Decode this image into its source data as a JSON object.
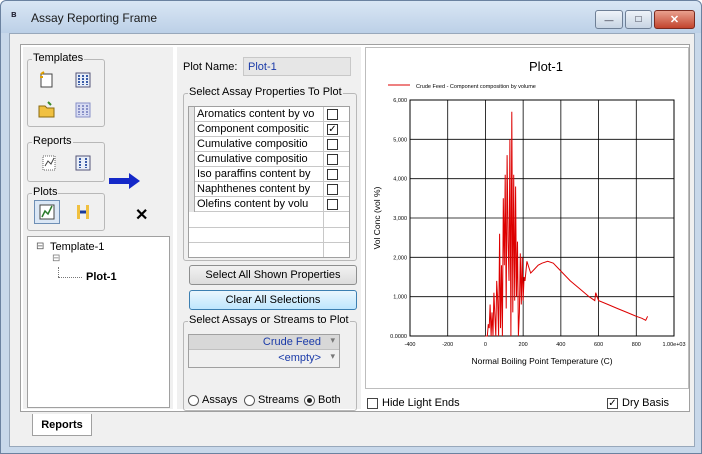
{
  "window": {
    "title": "Assay Reporting Frame",
    "controls": {
      "minimize": "—",
      "maximize": "□",
      "close": "✕"
    }
  },
  "left": {
    "templates_label": "Templates",
    "reports_label": "Reports",
    "plots_label": "Plots",
    "tree": {
      "root_toggle": "⊟",
      "root": "Template-1",
      "child_toggle": "⊟",
      "child": "Plot-1"
    }
  },
  "middle": {
    "plot_name_label": "Plot Name:",
    "plot_name_value": "Plot-1",
    "props_group_label": "Select Assay Properties To Plot",
    "properties": [
      {
        "label": "Aromatics content by vo",
        "checked": ""
      },
      {
        "label": "Component compositic",
        "checked": "✓"
      },
      {
        "label": "Cumulative compositio",
        "checked": ""
      },
      {
        "label": "Cumulative compositio",
        "checked": ""
      },
      {
        "label": "Iso paraffins content by",
        "checked": ""
      },
      {
        "label": "Naphthenes content by",
        "checked": ""
      },
      {
        "label": "Olefins content by volu",
        "checked": ""
      }
    ],
    "select_all_btn": "Select All Shown Properties",
    "clear_all_btn": "Clear All Selections",
    "streams_group_label": "Select Assays or Streams to Plot",
    "streams": [
      "Crude Feed",
      "<empty>"
    ],
    "radio": {
      "assays": "Assays",
      "streams": "Streams",
      "both": "Both",
      "selected": "both"
    }
  },
  "plot": {
    "hide_light_ends": "Hide Light Ends",
    "dry_basis": "Dry Basis",
    "dry_basis_checked": "✓",
    "hide_light_ends_checked": ""
  },
  "tabs": {
    "reports": "Reports"
  },
  "colors": {
    "series": "#dd0000",
    "arrow": "#1428c8"
  },
  "chart_data": {
    "type": "line",
    "title": "Plot-1",
    "xlabel": "Normal Boiling Point Temperature (C)",
    "ylabel": "Vol Conc (vol %)",
    "xlim": [
      -400,
      1000
    ],
    "ylim": [
      0,
      6000
    ],
    "xticks": [
      "-400",
      "-200",
      "0",
      "200",
      "400",
      "600",
      "800",
      "1.00e+03"
    ],
    "yticks": [
      "0.0000",
      "1,000",
      "2,000",
      "3,000",
      "4,000",
      "5,000",
      "6,000"
    ],
    "grid": true,
    "legend_position": "top-left",
    "series": [
      {
        "name": "Crude Feed - Component composition by volume",
        "x": [
          0,
          10,
          15,
          20,
          25,
          30,
          35,
          40,
          45,
          50,
          55,
          60,
          65,
          70,
          75,
          80,
          85,
          90,
          95,
          100,
          105,
          110,
          115,
          120,
          125,
          130,
          135,
          140,
          145,
          150,
          155,
          160,
          165,
          170,
          175,
          180,
          185,
          190,
          195,
          200,
          205,
          210,
          220,
          240,
          260,
          280,
          300,
          330,
          360,
          400,
          450,
          500,
          550,
          580,
          585,
          600,
          650,
          700,
          750,
          800,
          830,
          850,
          860
        ],
        "y": [
          0,
          0,
          300,
          200,
          800,
          0,
          600,
          0,
          1100,
          500,
          0,
          1400,
          900,
          0,
          2600,
          200,
          1800,
          0,
          3500,
          1800,
          4100,
          700,
          4600,
          2400,
          1400,
          5000,
          0,
          5700,
          600,
          4100,
          900,
          3800,
          1000,
          2400,
          0,
          600,
          2100,
          800,
          2000,
          900,
          1500,
          1400,
          1900,
          1600,
          1700,
          1800,
          1850,
          1900,
          1850,
          1650,
          1400,
          1200,
          1000,
          900,
          1100,
          900,
          800,
          700,
          600,
          500,
          450,
          400,
          500
        ]
      }
    ]
  }
}
